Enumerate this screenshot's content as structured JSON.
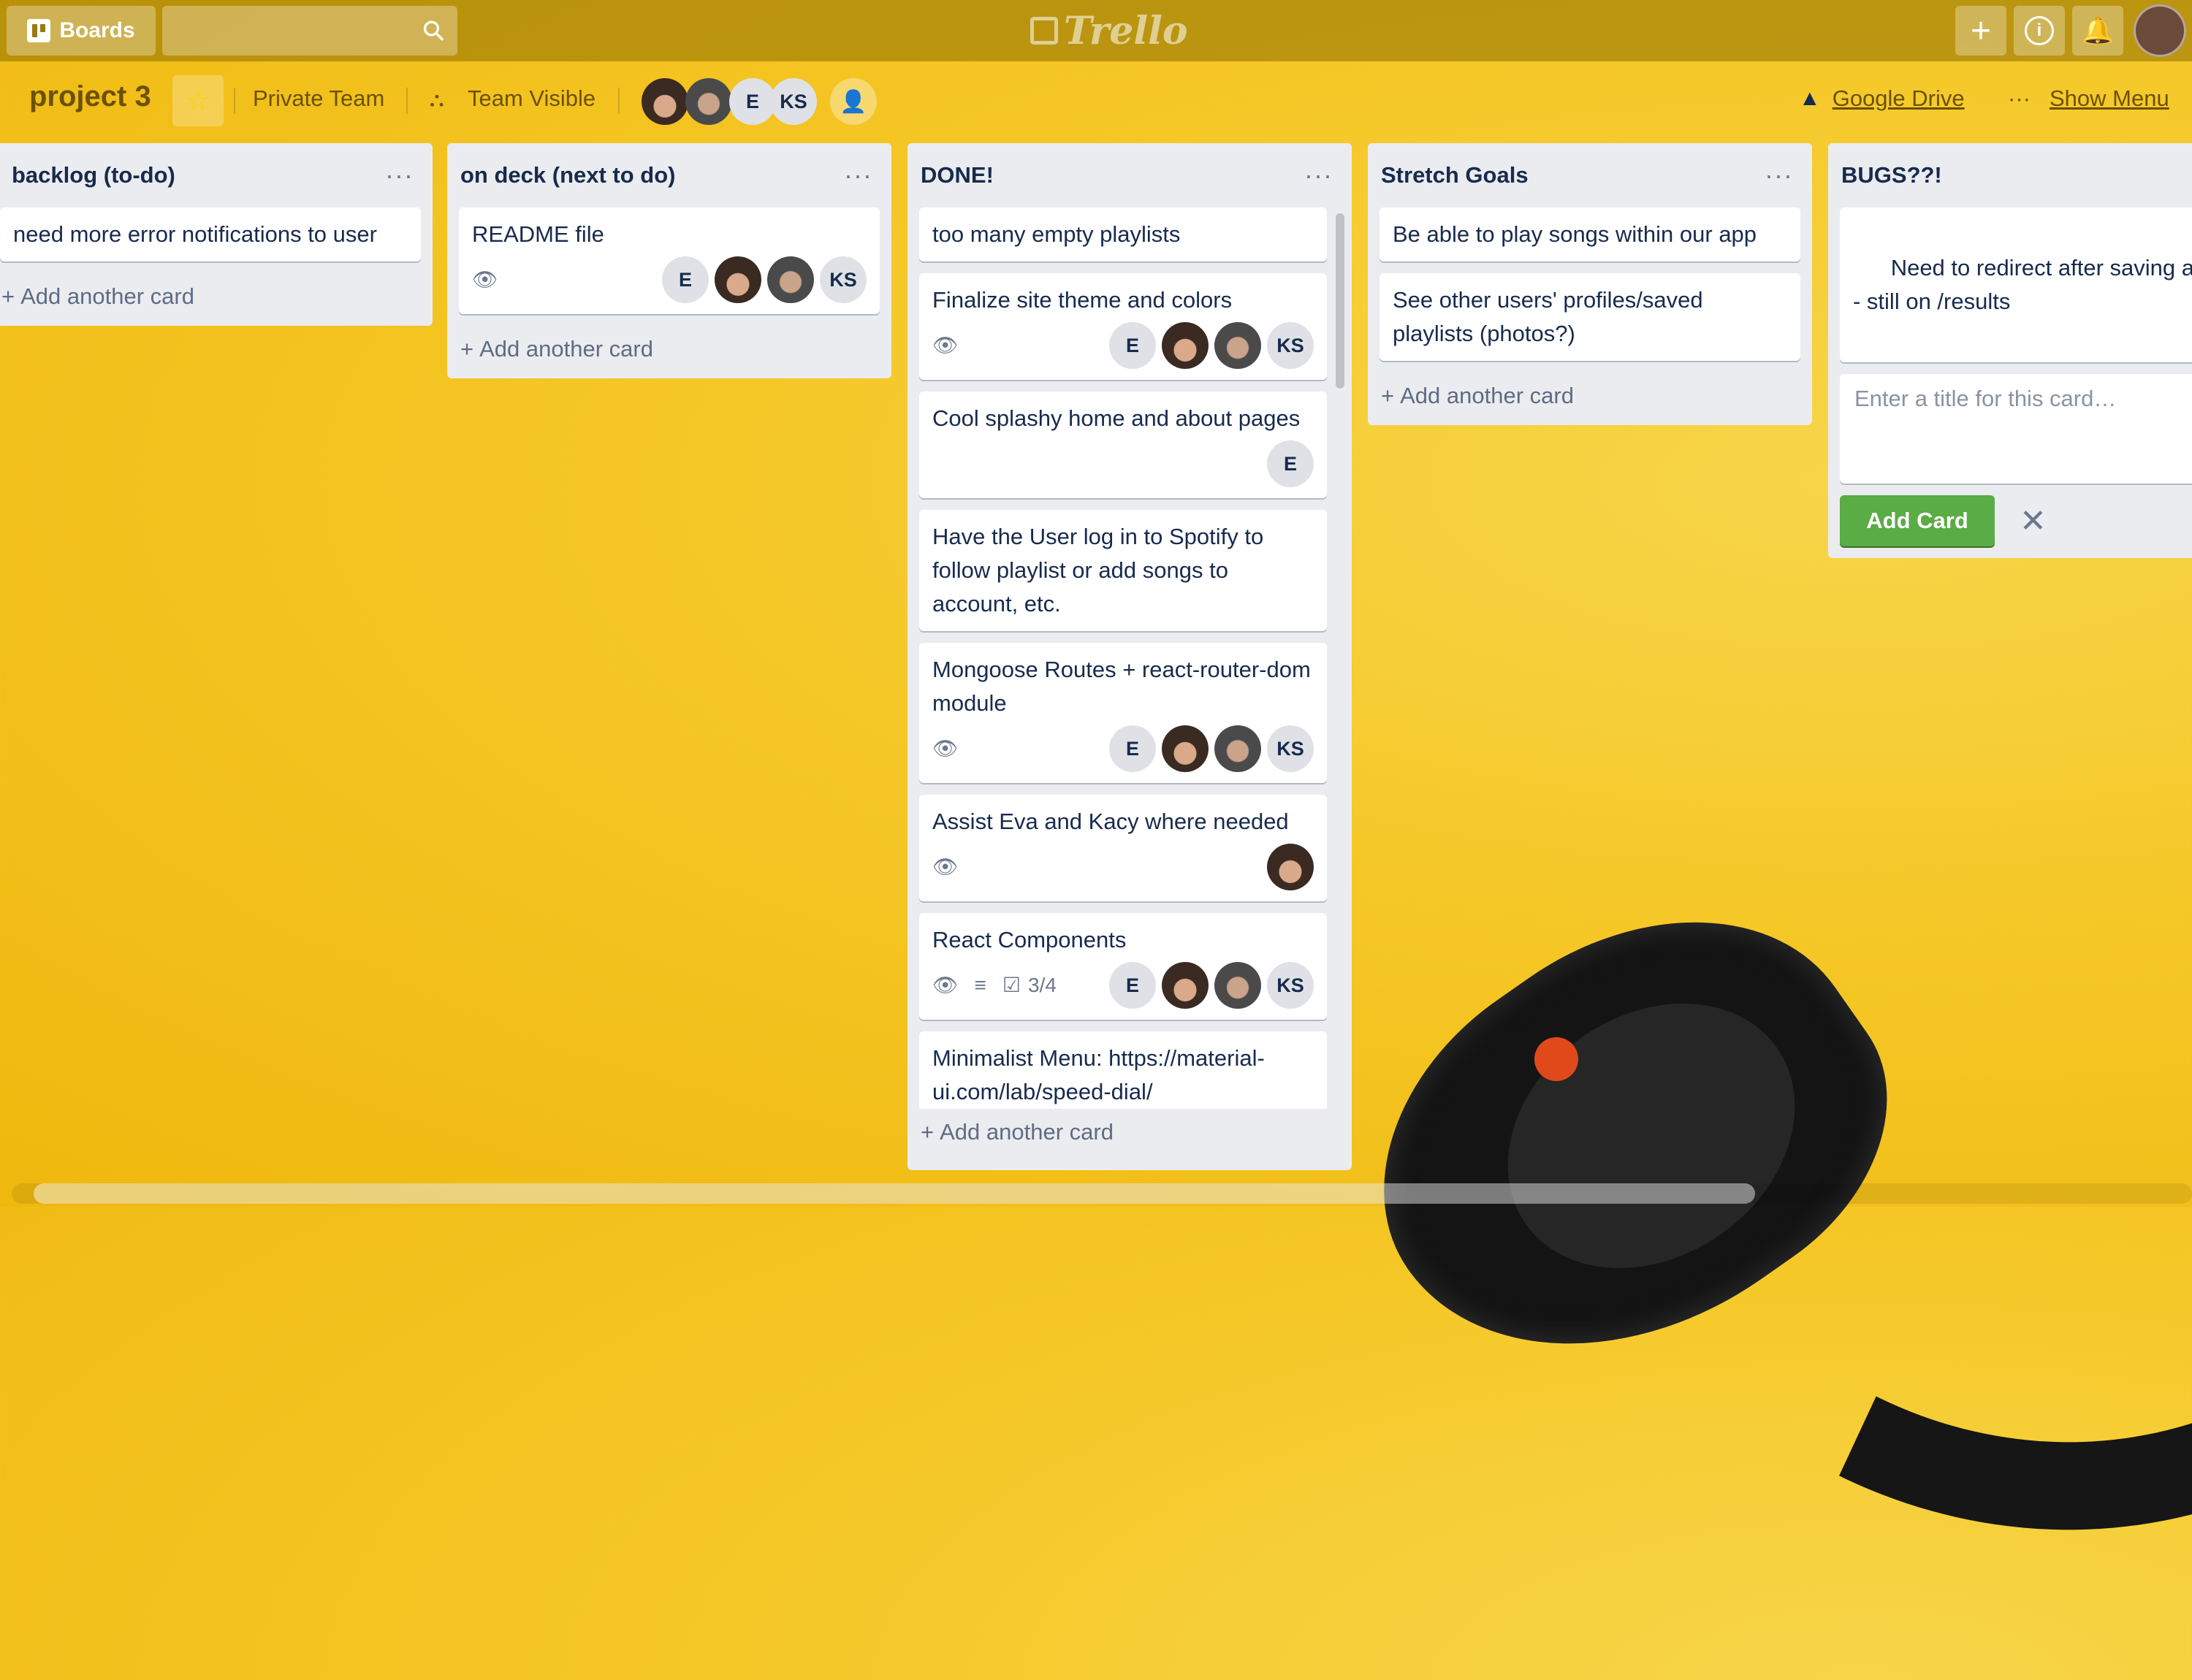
{
  "topbar": {
    "boards_label": "Boards",
    "search_value": "",
    "logo_text": "Trello",
    "plus": "+",
    "info": "i",
    "bell": "🔔"
  },
  "board": {
    "title": "project 3",
    "team": "Private Team",
    "visibility": "Team Visible",
    "members": [
      "E",
      "KS"
    ],
    "google_drive": "Google Drive",
    "show_menu": "Show Menu",
    "menu_dots": "···"
  },
  "lists": [
    {
      "title": "backlog (to-do)",
      "cards": [
        {
          "text": "need more error notifications to user"
        }
      ],
      "add_card": "Add another card"
    },
    {
      "title": "on deck (next to do)",
      "cards": [
        {
          "text": "README file",
          "members": [
            "E",
            "KS"
          ]
        }
      ],
      "add_card": "Add another card"
    },
    {
      "title": "DONE!",
      "cards": [
        {
          "text": "too many empty playlists"
        },
        {
          "text": "Finalize site theme and colors",
          "members": [
            "E",
            "KS"
          ]
        },
        {
          "text": "Cool splashy home and about pages",
          "members": [
            "E"
          ]
        },
        {
          "text": "Have the User log in to Spotify to follow playlist or add songs to account, etc."
        },
        {
          "text": "Mongoose Routes + react-router-dom module",
          "members": [
            "E",
            "KS"
          ]
        },
        {
          "text": "Assist Eva and Kacy where needed"
        },
        {
          "text": "React Components",
          "checklist": "3/4",
          "members": [
            "E",
            "KS"
          ]
        },
        {
          "text": "Minimalist Menu: https://material-ui.com/lab/speed-dial/"
        }
      ],
      "add_card": "Add another card"
    },
    {
      "title": "Stretch Goals",
      "cards": [
        {
          "text": "Be able to play songs within our app"
        },
        {
          "text": "See other users' profiles/saved playlists (photos?)"
        }
      ],
      "add_card": "Add another card"
    },
    {
      "title": "BUGS??!",
      "cards": [
        {
          "text": "Need to redirect after saving a pla\n- still on /results"
        }
      ],
      "composer_placeholder": "Enter a title for this card…",
      "add_button": "Add Card"
    }
  ]
}
